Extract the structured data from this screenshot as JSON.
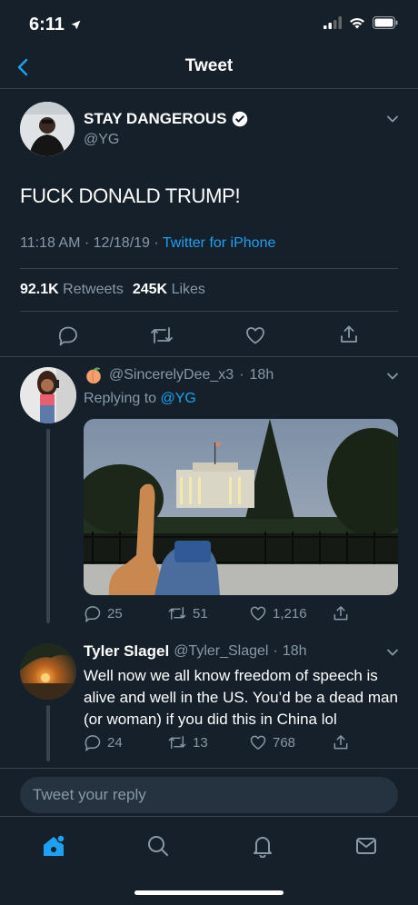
{
  "status_bar": {
    "time": "6:11"
  },
  "nav": {
    "title": "Tweet"
  },
  "tweet": {
    "display_name": "STAY DANGEROUS",
    "handle": "@YG",
    "text": "FUCK DONALD TRUMP!",
    "time": "11:18 AM",
    "date": "12/18/19",
    "source": "Twitter for iPhone",
    "retweets_count": "92.1K",
    "retweets_label": "Retweets",
    "likes_count": "245K",
    "likes_label": "Likes",
    "sep": "·"
  },
  "replies": [
    {
      "handle": "@SincerelyDee_x3",
      "age": "18h",
      "replying_to_label": "Replying to",
      "replying_to_handle": "@YG",
      "reply_count": "25",
      "retweet_count": "51",
      "like_count": "1,216"
    },
    {
      "display_name": "Tyler Slagel",
      "handle": "@Tyler_Slagel",
      "age": "18h",
      "text": "Well now we all know freedom of speech is alive and well in the US. You’d be a dead man (or woman) if you did this in China lol",
      "reply_count": "24",
      "retweet_count": "13",
      "like_count": "768"
    }
  ],
  "composer": {
    "placeholder": "Tweet your reply"
  },
  "colors": {
    "background": "#15202b",
    "accent": "#1da1f2",
    "muted": "#8899a6",
    "divider": "#38444d"
  }
}
